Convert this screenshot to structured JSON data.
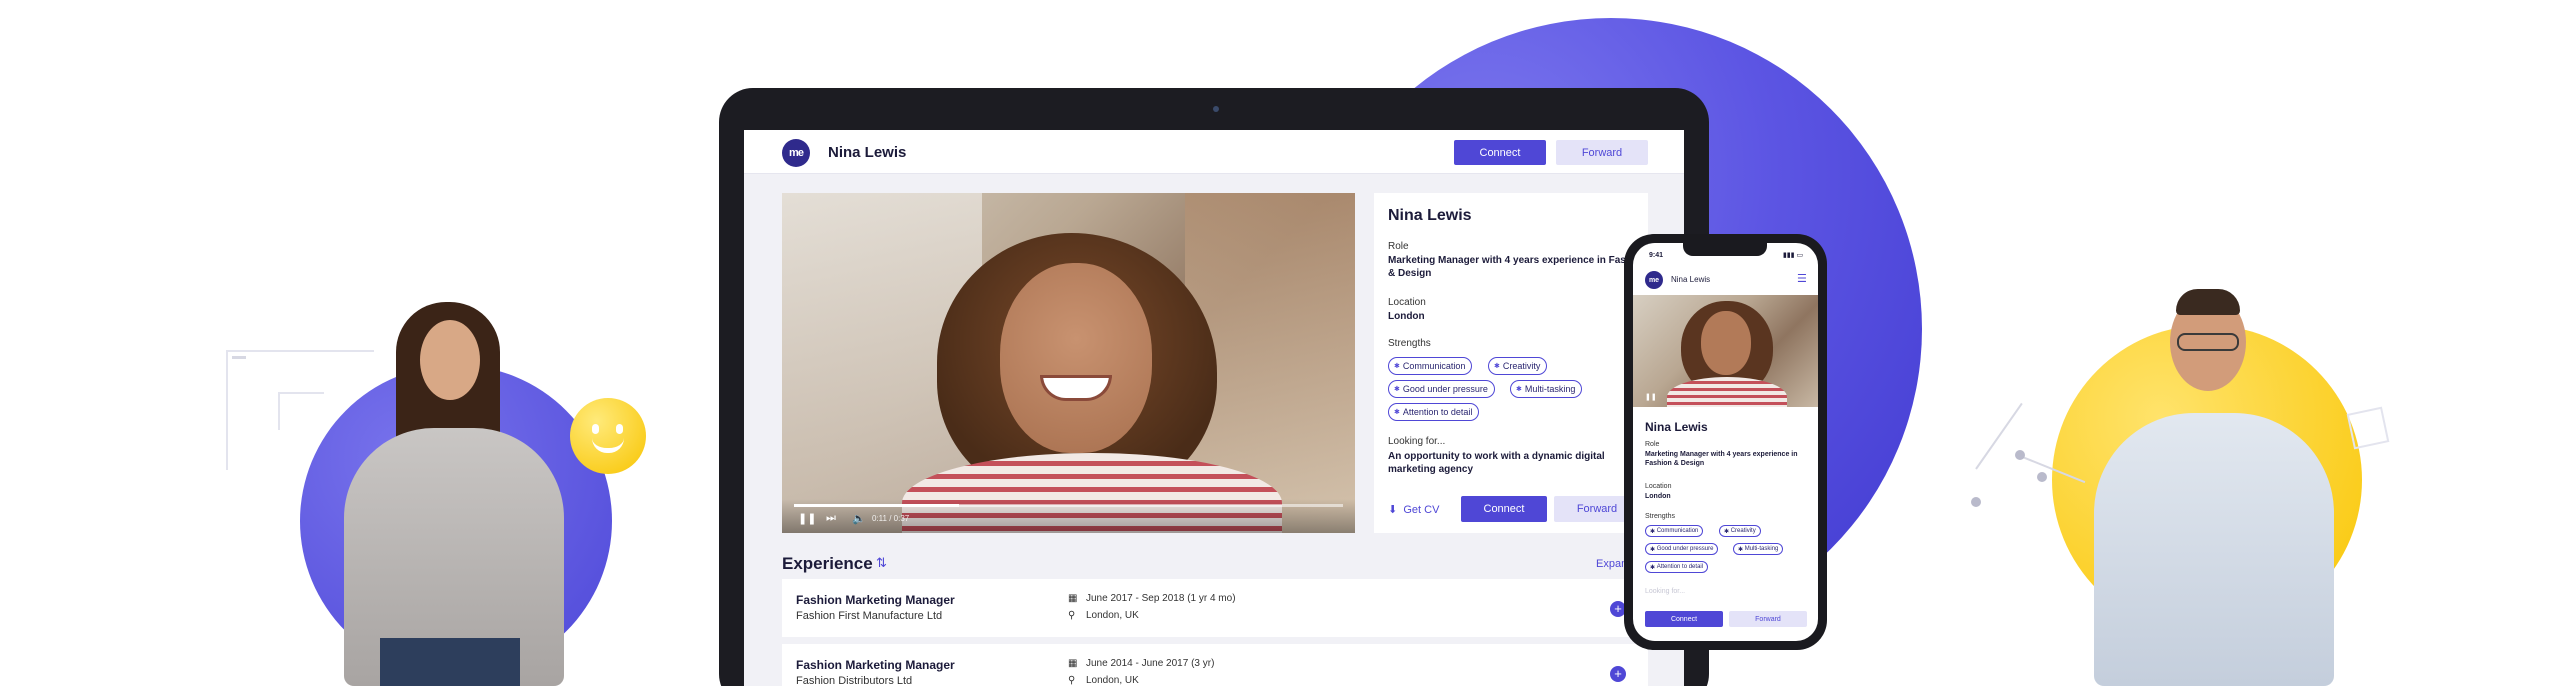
{
  "colors": {
    "accent": "#4f47d6",
    "accent_light": "#e4e3f8",
    "yellow": "#f9c500",
    "dark": "#1c1b3a"
  },
  "logo_text": "me",
  "header": {
    "name": "Nina Lewis",
    "connect_label": "Connect",
    "forward_label": "Forward"
  },
  "video": {
    "time_label": "0:11 / 0:37",
    "progress": 0.3
  },
  "profile": {
    "name": "Nina Lewis",
    "role_label": "Role",
    "role_value": "Marketing Manager with 4 years experience in Fashion & Design",
    "location_label": "Location",
    "location_value": "London",
    "strengths_label": "Strengths",
    "strengths": [
      "Communication",
      "Creativity",
      "Good under pressure",
      "Multi-tasking",
      "Attention to detail"
    ],
    "looking_label": "Looking for...",
    "looking_value": "An opportunity to work with a dynamic digital marketing agency",
    "get_cv_label": "Get CV",
    "connect_label": "Connect",
    "forward_label": "Forward"
  },
  "experience": {
    "title": "Experience",
    "expand_label": "Expand",
    "items": [
      {
        "role": "Fashion Marketing Manager",
        "company": "Fashion First Manufacture Ltd",
        "dates": "June 2017 - Sep 2018  (1 yr 4 mo)",
        "location": "London, UK"
      },
      {
        "role": "Fashion Marketing Manager",
        "company": "Fashion Distributors Ltd",
        "dates": "June 2014 - June 2017  (3 yr)",
        "location": "London, UK"
      }
    ]
  },
  "phone": {
    "time": "9:41",
    "name": "Nina Lewis",
    "title": "Nina Lewis",
    "role_label": "Role",
    "role_value": "Marketing Manager with 4 years experience in Fashion & Design",
    "location_label": "Location",
    "location_value": "London",
    "strengths_label": "Strengths",
    "strengths": [
      "Communication",
      "Creativity",
      "Good under pressure",
      "Multi-tasking",
      "Attention to detail"
    ],
    "looking_label": "Looking for...",
    "connect_label": "Connect",
    "forward_label": "Forward"
  }
}
